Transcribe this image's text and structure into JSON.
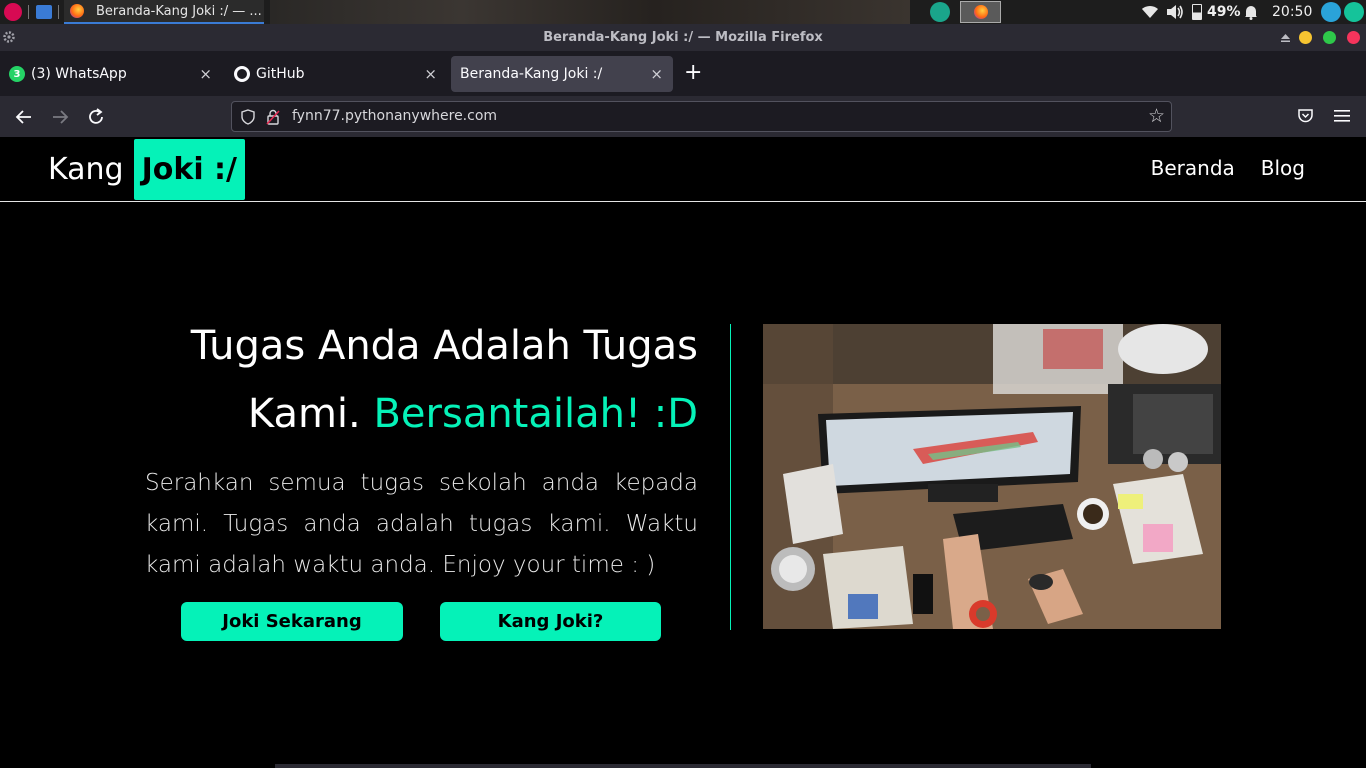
{
  "taskbar": {
    "task_title": "Beranda-Kang Joki :/ — ...",
    "battery": "49%",
    "clock": "20:50"
  },
  "window": {
    "title": "Beranda-Kang Joki :/ — Mozilla Firefox"
  },
  "tabs": [
    {
      "label": "(3) WhatsApp",
      "badge": "3"
    },
    {
      "label": "GitHub"
    },
    {
      "label": "Beranda-Kang Joki :/"
    }
  ],
  "tab_close": "×",
  "new_tab": "+",
  "urlbar": {
    "url": "fynn77.pythonanywhere.com"
  },
  "site": {
    "brand_left": "Kang",
    "brand_right": "Joki :/",
    "nav": [
      "Beranda",
      "Blog"
    ],
    "hero_title_line1": "Tugas Anda Adalah Tugas",
    "hero_title_line2": "Kami.",
    "hero_title_accent": "Bersantailah! :D",
    "hero_desc": "Serahkan semua tugas sekolah anda kepada kami. Tugas anda adalah tugas kami. Waktu kami adalah waktu anda. Enjoy your time : )",
    "cta_primary": "Joki Sekarang",
    "cta_secondary": "Kang Joki?"
  },
  "colors": {
    "accent": "#05f2b8",
    "page_bg": "#000000"
  }
}
